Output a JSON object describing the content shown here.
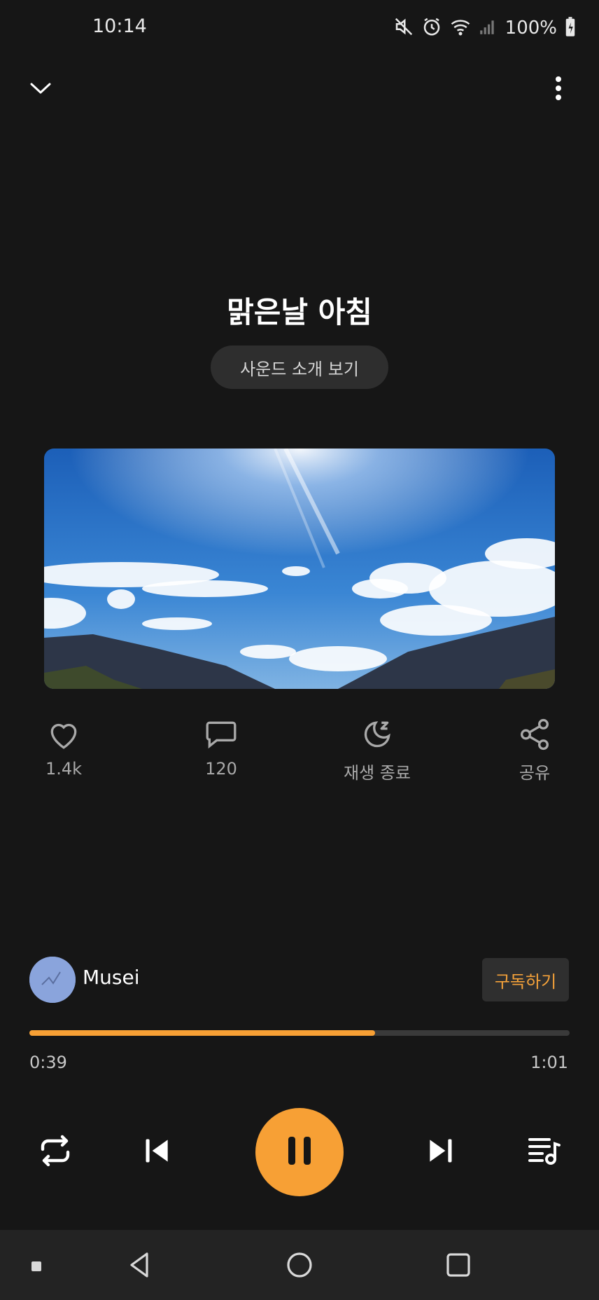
{
  "status_bar": {
    "time": "10:14",
    "battery": "100%",
    "icons": [
      "mute-icon",
      "alarm-icon",
      "wifi-icon",
      "signal-icon",
      "battery-charging-icon"
    ]
  },
  "header": {
    "icons": [
      "chevron-down-icon",
      "more-vertical-icon"
    ]
  },
  "track": {
    "title": "맑은날 아침",
    "intro_button": "사운드 소개 보기"
  },
  "actions": {
    "like_count": "1.4k",
    "comment_count": "120",
    "sleep_timer_label": "재생 종료",
    "share_label": "공유"
  },
  "artist": {
    "name": "Musei",
    "subscribe_label": "구독하기"
  },
  "player": {
    "current_time": "0:39",
    "total_time": "1:01",
    "progress_fraction": 0.64,
    "accent_color": "#f7a035",
    "controls": [
      "repeat-icon",
      "previous-icon",
      "pause-icon",
      "next-icon",
      "playlist-icon"
    ]
  },
  "navigation_bar": {
    "icons": [
      "recent-dot-icon",
      "back-icon",
      "home-icon",
      "recents-icon"
    ]
  }
}
